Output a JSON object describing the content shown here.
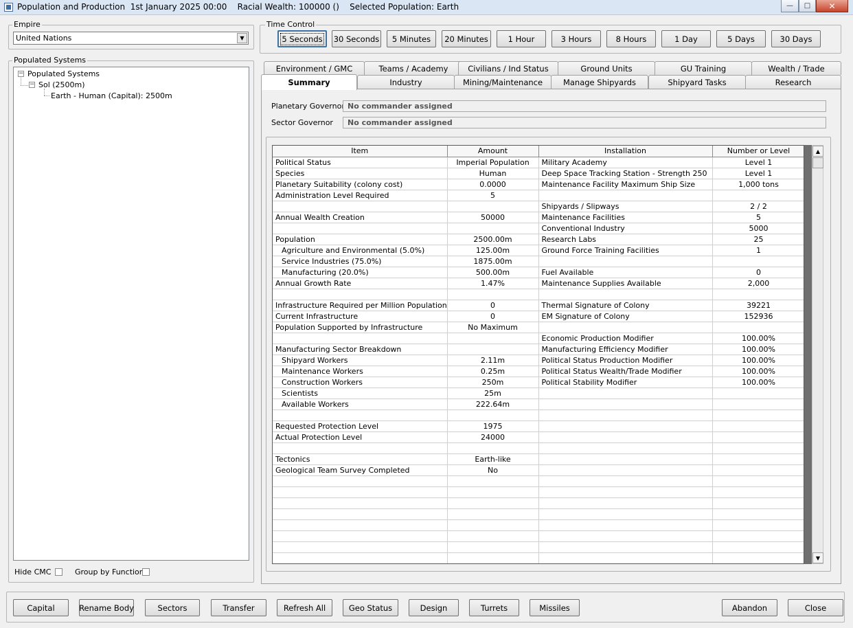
{
  "window": {
    "title": "Population and Production  1st January 2025 00:00    Racial Wealth: 100000 ()    Selected Population: Earth",
    "min": "—",
    "max": "□",
    "close": "✕"
  },
  "empire": {
    "label": "Empire",
    "value": "United Nations"
  },
  "time_control": {
    "label": "Time Control",
    "buttons": [
      "5 Seconds",
      "30 Seconds",
      "5 Minutes",
      "20 Minutes",
      "1 Hour",
      "3 Hours",
      "8 Hours",
      "1 Day",
      "5 Days",
      "30 Days"
    ],
    "selected": "5 Seconds"
  },
  "systems": {
    "label": "Populated Systems",
    "tree": {
      "root": "Populated Systems",
      "system": "Sol (2500m)",
      "body": "Earth - Human (Capital): 2500m",
      "collapse_glyph": "−"
    }
  },
  "options": {
    "hide_cmc": "Hide CMC",
    "group_by_function": "Group by Function"
  },
  "tabs": {
    "row1": [
      "Environment / GMC",
      "Teams / Academy",
      "Civilians / Ind Status",
      "Ground Units",
      "GU Training",
      "Wealth / Trade"
    ],
    "row2": [
      "Summary",
      "Industry",
      "Mining/Maintenance",
      "Manage Shipyards",
      "Shipyard Tasks",
      "Research"
    ],
    "active": "Summary"
  },
  "governors": {
    "planetary_label": "Planetary Governor",
    "planetary_value": "No commander assigned",
    "sector_label": "Sector Governor",
    "sector_value": "No commander assigned"
  },
  "table": {
    "headers": [
      "Item",
      "Amount",
      "Installation",
      "Number or Level"
    ],
    "rows": [
      [
        "Political Status",
        "Imperial Population",
        "Military Academy",
        "Level 1"
      ],
      [
        "Species",
        "Human",
        "Deep Space Tracking Station - Strength 250",
        "Level 1"
      ],
      [
        "Planetary Suitability (colony cost)",
        "0.0000",
        "Maintenance Facility Maximum Ship Size",
        "1,000 tons"
      ],
      [
        "Administration Level Required",
        "5",
        "",
        ""
      ],
      [
        "",
        "",
        "Shipyards / Slipways",
        "2 / 2"
      ],
      [
        "Annual Wealth Creation",
        "50000",
        "Maintenance Facilities",
        "5"
      ],
      [
        "",
        "",
        "Conventional Industry",
        "5000"
      ],
      [
        "Population",
        "2500.00m",
        "Research Labs",
        "25"
      ],
      [
        "Agriculture and Environmental  (5.0%)",
        "125.00m",
        "Ground Force Training Facilities",
        "1"
      ],
      [
        "Service Industries  (75.0%)",
        "1875.00m",
        "",
        ""
      ],
      [
        "Manufacturing  (20.0%)",
        "500.00m",
        "Fuel Available",
        "0"
      ],
      [
        "Annual Growth Rate",
        "1.47%",
        "Maintenance Supplies Available",
        "2,000"
      ],
      [
        "",
        "",
        "",
        ""
      ],
      [
        "Infrastructure Required per Million Population",
        "0",
        "Thermal Signature of Colony",
        "39221"
      ],
      [
        "Current Infrastructure",
        "0",
        "EM Signature of Colony",
        "152936"
      ],
      [
        "Population Supported by Infrastructure",
        "No Maximum",
        "",
        ""
      ],
      [
        "",
        "",
        "Economic Production Modifier",
        "100.00%"
      ],
      [
        "Manufacturing Sector Breakdown",
        "",
        "Manufacturing Efficiency Modifier",
        "100.00%"
      ],
      [
        "Shipyard Workers",
        "2.11m",
        "Political Status Production Modifier",
        "100.00%"
      ],
      [
        "Maintenance Workers",
        "0.25m",
        "Political Status Wealth/Trade Modifier",
        "100.00%"
      ],
      [
        "Construction Workers",
        "250m",
        "Political Stability Modifier",
        "100.00%"
      ],
      [
        "Scientists",
        "25m",
        "",
        ""
      ],
      [
        "Available Workers",
        "222.64m",
        "",
        ""
      ],
      [
        "",
        "",
        "",
        ""
      ],
      [
        "Requested Protection Level",
        "1975",
        "",
        ""
      ],
      [
        "Actual Protection Level",
        "24000",
        "",
        ""
      ],
      [
        "",
        "",
        "",
        ""
      ],
      [
        "Tectonics",
        "Earth-like",
        "",
        ""
      ],
      [
        "Geological Team Survey Completed",
        "No",
        "",
        ""
      ],
      [
        "",
        "",
        "",
        ""
      ],
      [
        "",
        "",
        "",
        ""
      ],
      [
        "",
        "",
        "",
        ""
      ],
      [
        "",
        "",
        "",
        ""
      ],
      [
        "",
        "",
        "",
        ""
      ],
      [
        "",
        "",
        "",
        ""
      ],
      [
        "",
        "",
        "",
        ""
      ],
      [
        "",
        "",
        "",
        ""
      ]
    ],
    "indented_rows": [
      8,
      9,
      10,
      18,
      19,
      20,
      21,
      22
    ]
  },
  "bottom_buttons": [
    "Capital",
    "Rename Body",
    "Sectors",
    "Transfer",
    "Refresh All",
    "Geo Status",
    "Design",
    "Turrets",
    "Missiles"
  ],
  "right_buttons": [
    "Abandon",
    "Close"
  ],
  "scroll": {
    "up": "▲",
    "down": "▼"
  },
  "icons": {
    "combo": "chevron-down-icon",
    "app": "app-icon",
    "tree_toggle": "minus-box-icon"
  }
}
